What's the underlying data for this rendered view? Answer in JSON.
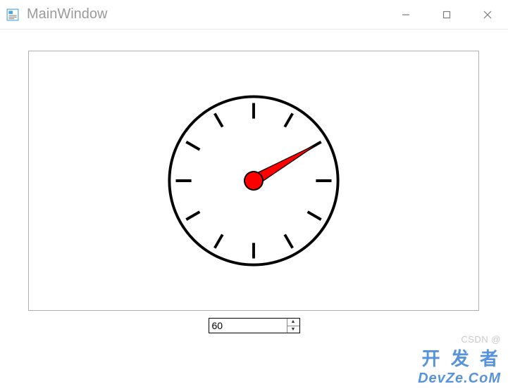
{
  "window": {
    "title": "MainWindow"
  },
  "gauge": {
    "value": 60,
    "min": 0,
    "max": 360,
    "tick_count": 12,
    "needle_color": "#ff0000",
    "hub_color": "#ff0000",
    "dial_outline": "#000000"
  },
  "spinbox": {
    "value": "60"
  },
  "watermark": {
    "csdn": "CSDN @",
    "brand_cn": "开 发 者",
    "brand_en": "DevZe.CoM"
  }
}
